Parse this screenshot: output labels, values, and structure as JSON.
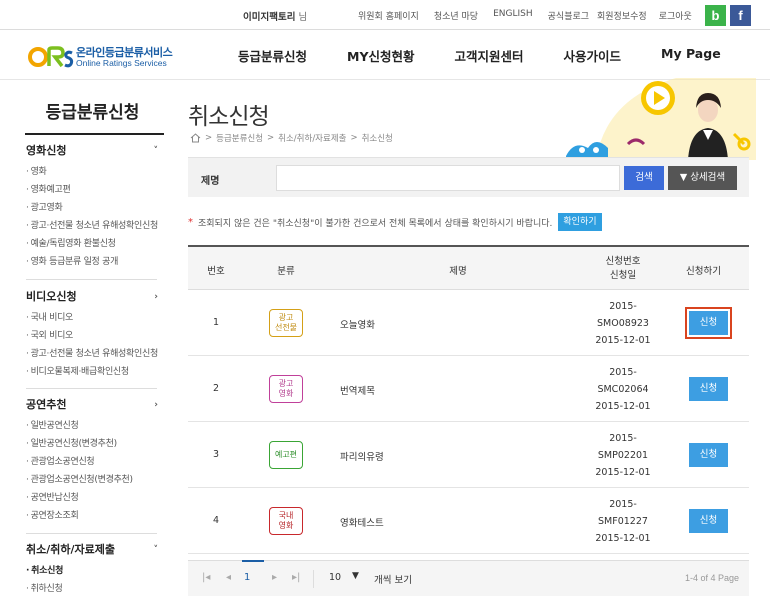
{
  "topbar": {
    "user_name": "이미지팩토리",
    "user_suffix": "님",
    "links": [
      "위원회 홈페이지",
      "청소년 마당",
      "ENGLISH",
      "공식블로그"
    ],
    "account_links": [
      "회원정보수정",
      "로그아웃"
    ],
    "sns": [
      "b",
      "f"
    ]
  },
  "logo": {
    "name_ko": "온라인등급분류서비스",
    "name_en": "Online Ratings Services"
  },
  "gnb": [
    "등급분류신청",
    "MY신청현황",
    "고객지원센터",
    "사용가이드",
    "My Page"
  ],
  "sidebar": {
    "title": "등급분류신청",
    "groups": [
      {
        "title": "영화신청",
        "arrow": "˅",
        "items": [
          "영화",
          "영화예고편",
          "광고영화",
          "광고·선전물 청소년 유해성확인신청",
          "예술/독립영화 환불신청",
          "영화 등급분류 일정 공개"
        ]
      },
      {
        "title": "비디오신청",
        "arrow": "›",
        "items": [
          "국내 비디오",
          "국외 비디오",
          "광고·선전물 청소년 유해성확인신청",
          "비디오물복제·배급확인신청"
        ]
      },
      {
        "title": "공연추천",
        "arrow": "›",
        "items": [
          "일반공연신청",
          "일반공연신청(변경추천)",
          "관광업소공연신청",
          "관광업소공연신청(변경추천)",
          "공연반납신청",
          "공연장소조회"
        ]
      },
      {
        "title": "취소/취하/자료제출",
        "arrow": "˅",
        "items": [
          "취소신청",
          "취하신청"
        ]
      }
    ]
  },
  "page": {
    "title": "취소신청",
    "breadcrumb": [
      "등급분류신청",
      "취소/취하/자료제출",
      "취소신청"
    ]
  },
  "search": {
    "label": "제명",
    "value": "",
    "search_btn": "검색",
    "detail_btn": "상세검색"
  },
  "notice": {
    "text": "조회되지 않은 건은 \"취소신청\"이 불가한 건으로서 전체 목록에서 상태를 확인하시기 바랍니다.",
    "button": "확인하기"
  },
  "table": {
    "headers": {
      "no": "번호",
      "category": "분류",
      "title": "제명",
      "app_no": "신청번호",
      "app_date": "신청일",
      "action": "신청하기"
    },
    "rows": [
      {
        "no": "1",
        "category": "광고\n선전물",
        "color": "#d4a017",
        "title": "오늘영화",
        "app_no_1": "2015-",
        "app_no_2": "SMO08923",
        "date": "2015-12-01",
        "action": "신청"
      },
      {
        "no": "2",
        "category": "광고\n영화",
        "color": "#c0409a",
        "title": "번역제목",
        "app_no_1": "2015-",
        "app_no_2": "SMC02064",
        "date": "2015-12-01",
        "action": "신청"
      },
      {
        "no": "3",
        "category": "예고편",
        "color": "#3aa535",
        "title": "파리의유령",
        "app_no_1": "2015-",
        "app_no_2": "SMP02201",
        "date": "2015-12-01",
        "action": "신청"
      },
      {
        "no": "4",
        "category": "국내\n영화",
        "color": "#c8282c",
        "title": "영화테스트",
        "app_no_1": "2015-",
        "app_no_2": "SMF01227",
        "date": "2015-12-01",
        "action": "신청"
      }
    ]
  },
  "pager": {
    "current": "1",
    "page_size": "10",
    "per_label": "개씩 보기",
    "count": "1-4 of 4 Page"
  }
}
